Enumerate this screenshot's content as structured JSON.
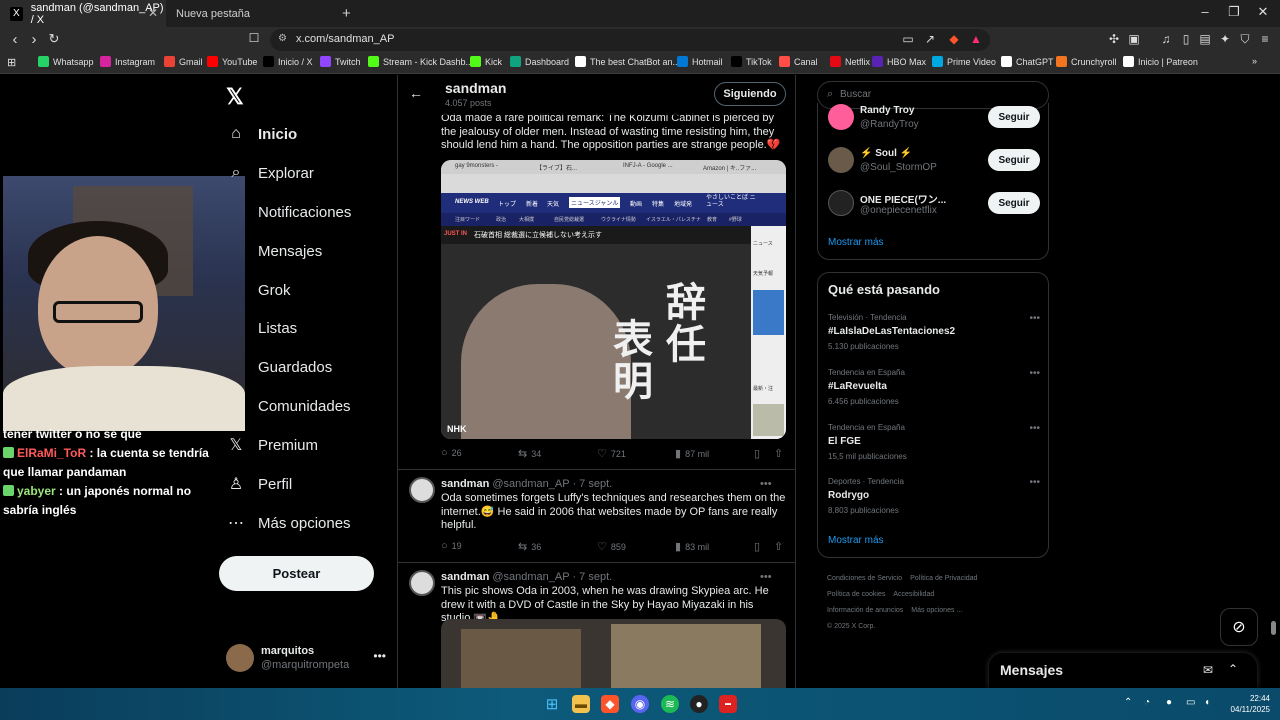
{
  "browser": {
    "tabs": [
      {
        "title": "sandman (@sandman_AP) / X",
        "favicon": "X"
      },
      {
        "title": "Nueva pestaña"
      }
    ],
    "new_tab_icon": "+",
    "url": "x.com/sandman_AP",
    "bookmarks": [
      {
        "label": "Whatsapp",
        "icon": "whatsapp-icon",
        "color": "#25d366"
      },
      {
        "label": "Instagram",
        "icon": "instagram-icon",
        "color": "#d6249f"
      },
      {
        "label": "Gmail",
        "icon": "gmail-icon",
        "color": "#ea4335"
      },
      {
        "label": "YouTube",
        "icon": "youtube-icon",
        "color": "#ff0000"
      },
      {
        "label": "Inicio / X",
        "icon": "x-icon",
        "color": "#000000"
      },
      {
        "label": "Twitch",
        "icon": "twitch-icon",
        "color": "#9146ff"
      },
      {
        "label": "Stream - Kick Dashb...",
        "icon": "kick-icon",
        "color": "#53fc18"
      },
      {
        "label": "Kick",
        "icon": "kick-icon",
        "color": "#53fc18"
      },
      {
        "label": "Dashboard",
        "icon": "dashboard-icon",
        "color": "#10a37f"
      },
      {
        "label": "The best ChatBot an...",
        "icon": "chatbot-icon",
        "color": "#ffffff"
      },
      {
        "label": "Hotmail",
        "icon": "outlook-icon",
        "color": "#0078d4"
      },
      {
        "label": "TikTok",
        "icon": "tiktok-icon",
        "color": "#000000"
      },
      {
        "label": "Canal",
        "icon": "youtube-studio-icon",
        "color": "#ff4e45"
      },
      {
        "label": "Netflix",
        "icon": "netflix-icon",
        "color": "#e50914"
      },
      {
        "label": "HBO Max",
        "icon": "hbo-icon",
        "color": "#5822b4"
      },
      {
        "label": "Prime Video",
        "icon": "prime-icon",
        "color": "#00a8e1"
      },
      {
        "label": "ChatGPT",
        "icon": "chatgpt-icon",
        "color": "#ffffff"
      },
      {
        "label": "Crunchyroll",
        "icon": "crunchyroll-icon",
        "color": "#f47521"
      },
      {
        "label": "Inicio | Patreon",
        "icon": "patreon-icon",
        "color": "#ffffff"
      }
    ]
  },
  "stream_chat": [
    {
      "user": "",
      "text": "tener twitter o no se que"
    },
    {
      "user": "ElRaMi_ToR",
      "text": " : la cuenta se tendría que llamar pandaman"
    },
    {
      "user": "yabyer",
      "text": " : un japonés normal no sabría inglés"
    }
  ],
  "nav": {
    "items": [
      "Inicio",
      "Explorar",
      "Notificaciones",
      "Mensajes",
      "Grok",
      "Listas",
      "Guardados",
      "Comunidades",
      "Premium",
      "Perfil",
      "Más opciones"
    ],
    "post_button": "Postear",
    "account": {
      "name": "marquitos",
      "handle": "@marquitrompeta"
    }
  },
  "profile_header": {
    "name": "sandman",
    "posts": "4.057 posts",
    "follow_button": "Siguiendo"
  },
  "tweets": [
    {
      "text": "Oda made a rare political remark: The Koizumi Cabinet is pierced by the jealousy of older men. Instead of wasting time resisting him, they should lend him a hand. The opposition parties are strange people.💔",
      "image": {
        "browser_tabs": [
          "gay 9monsters -",
          "【ライブ】石...",
          "INFJ-A - Google ...",
          "Amazon | キ..ファ..."
        ],
        "nav": [
          "NEWS WEB",
          "トップ",
          "新着",
          "天気",
          "ニュースジャンル",
          "動画",
          "特集",
          "地域発",
          "やさしいことば ニュース"
        ],
        "sub_nav": [
          "注目ワード",
          "政治",
          "大相撲",
          "自民党総裁選",
          "ウクライナ情勢",
          "イスラエル・パレスチナ",
          "教育",
          "#野球"
        ],
        "headline_tag": "JUST IN",
        "headline": "石破首相 総裁選に立候補しない考え示す",
        "caption_col1": "辞任",
        "caption_col2": "表明",
        "logo": "NHK",
        "side_labels": [
          "ニュース",
          "天気予報",
          "最新・注"
        ]
      },
      "replies": "26",
      "reposts": "34",
      "likes": "721",
      "views": "87 mil"
    },
    {
      "name": "sandman",
      "handle": "@sandman_AP",
      "date": "· 7 sept.",
      "text": "Oda sometimes forgets Luffy's techniques and researches them on the internet.😅 He said in 2006 that websites made by OP fans are really helpful.",
      "replies": "19",
      "reposts": "36",
      "likes": "859",
      "views": "83 mil"
    },
    {
      "name": "sandman",
      "handle": "@sandman_AP",
      "date": "· 7 sept.",
      "text": "This pic shows Oda in 2003, when he was drawing Skypiea arc. He drew it with a DVD of Castle in the Sky by Hayao Miyazaki in his studio.📼🤚"
    }
  ],
  "search": {
    "placeholder": "Buscar"
  },
  "who_to_follow": [
    {
      "name": "Randy Troy",
      "handle": "@RandyTroy",
      "button": "Seguir"
    },
    {
      "name": "⚡ Soul ⚡",
      "handle": "@Soul_StormOP",
      "button": "Seguir"
    },
    {
      "name": "ONE PIECE(ワン...",
      "handle": "@onepiecenetflix",
      "button": "Seguir"
    }
  ],
  "show_more": "Mostrar más",
  "trends": {
    "title": "Qué está pasando",
    "items": [
      {
        "context": "Televisión · Tendencia",
        "name": "#LaIslaDeLasTentaciones2",
        "count": "5.130 publicaciones"
      },
      {
        "context": "Tendencia en España",
        "name": "#LaRevuelta",
        "count": "6.456 publicaciones"
      },
      {
        "context": "Tendencia en España",
        "name": "El FGE",
        "count": "15,5 mil publicaciones"
      },
      {
        "context": "Deportes · Tendencia",
        "name": "Rodrygo",
        "count": "8.803 publicaciones"
      }
    ],
    "show_more": "Mostrar más"
  },
  "footer": {
    "links": [
      "Condiciones de Servicio",
      "Política de Privacidad",
      "Política de cookies",
      "Accesibilidad",
      "Información de anuncios",
      "Más opciones ..."
    ],
    "copyright": "© 2025 X Corp."
  },
  "messages_dock": {
    "title": "Mensajes"
  },
  "taskbar": {
    "time": "22:44",
    "date": "04/11/2025"
  }
}
